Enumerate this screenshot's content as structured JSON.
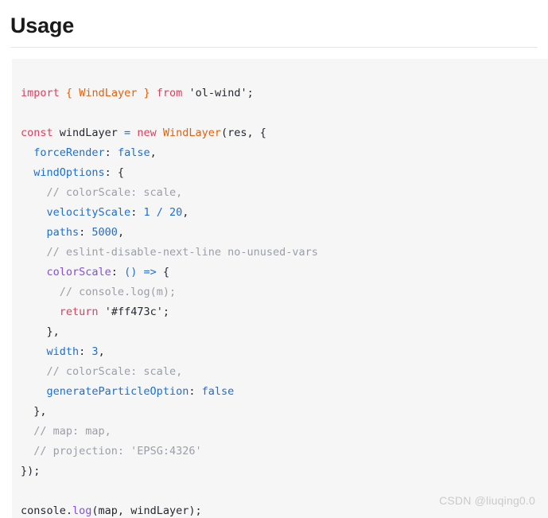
{
  "page": {
    "heading": "Usage",
    "watermark": "CSDN @liuqing0.0"
  },
  "colors": {
    "background": "#ffffff",
    "code_background": "#f6f6f7",
    "rule": "#e6e6e6",
    "heading_text": "#1a1a1a",
    "keyword": "#d9415f",
    "type": "#e36209",
    "property": "#1d6fd0",
    "number": "#1d6fd0",
    "boolean": "#1d6fd0",
    "function": "#8250df",
    "string": "#24292e",
    "comment": "#9aa0a6",
    "plain": "#24292e",
    "watermark": "#c9cacb"
  },
  "code": {
    "language": "javascript",
    "raw": "import { WindLayer } from 'ol-wind';\n\nconst windLayer = new WindLayer(res, {\n    forceRender: false,\n    windOptions: {\n      // colorScale: scale,\n      velocityScale: 1 / 20,\n      paths: 5000,\n      // eslint-disable-next-line no-unused-vars\n      colorScale: () => {\n        // console.log(m);\n        return '#ff473c';\n      },\n      width: 3,\n      // colorScale: scale,\n      generateParticleOption: false\n    },\n    // map: map,\n    // projection: 'EPSG:4326'\n});\n\nconsole.log(map, windLayer);",
    "lines": [
      {
        "indent": 0,
        "tokens": [
          {
            "t": "import",
            "c": "kw"
          },
          {
            "t": " ",
            "c": "plain"
          },
          {
            "t": "{",
            "c": "type"
          },
          {
            "t": " ",
            "c": "plain"
          },
          {
            "t": "WindLayer",
            "c": "type"
          },
          {
            "t": " ",
            "c": "plain"
          },
          {
            "t": "}",
            "c": "type"
          },
          {
            "t": " ",
            "c": "plain"
          },
          {
            "t": "from",
            "c": "kw"
          },
          {
            "t": " ",
            "c": "plain"
          },
          {
            "t": "'ol-wind';",
            "c": "str"
          }
        ]
      },
      {
        "indent": 0,
        "tokens": []
      },
      {
        "indent": 0,
        "tokens": [
          {
            "t": "const",
            "c": "kw"
          },
          {
            "t": " windLayer ",
            "c": "plain"
          },
          {
            "t": "=",
            "c": "op"
          },
          {
            "t": " ",
            "c": "plain"
          },
          {
            "t": "new",
            "c": "kw"
          },
          {
            "t": " ",
            "c": "plain"
          },
          {
            "t": "WindLayer",
            "c": "type"
          },
          {
            "t": "(res, {",
            "c": "plain"
          }
        ]
      },
      {
        "indent": 1,
        "tokens": [
          {
            "t": "forceRender",
            "c": "prop"
          },
          {
            "t": ": ",
            "c": "plain"
          },
          {
            "t": "false",
            "c": "bool"
          },
          {
            "t": ",",
            "c": "plain"
          }
        ]
      },
      {
        "indent": 1,
        "tokens": [
          {
            "t": "windOptions",
            "c": "prop"
          },
          {
            "t": ": {",
            "c": "plain"
          }
        ]
      },
      {
        "indent": 2,
        "tokens": [
          {
            "t": "// colorScale: scale,",
            "c": "comment"
          }
        ]
      },
      {
        "indent": 2,
        "tokens": [
          {
            "t": "velocityScale",
            "c": "prop"
          },
          {
            "t": ": ",
            "c": "plain"
          },
          {
            "t": "1",
            "c": "num"
          },
          {
            "t": " ",
            "c": "plain"
          },
          {
            "t": "/",
            "c": "op"
          },
          {
            "t": " ",
            "c": "plain"
          },
          {
            "t": "20",
            "c": "num"
          },
          {
            "t": ",",
            "c": "plain"
          }
        ]
      },
      {
        "indent": 2,
        "tokens": [
          {
            "t": "paths",
            "c": "prop"
          },
          {
            "t": ": ",
            "c": "plain"
          },
          {
            "t": "5000",
            "c": "num"
          },
          {
            "t": ",",
            "c": "plain"
          }
        ]
      },
      {
        "indent": 2,
        "tokens": [
          {
            "t": "// eslint-disable-next-line no-unused-vars",
            "c": "comment"
          }
        ]
      },
      {
        "indent": 2,
        "tokens": [
          {
            "t": "colorScale",
            "c": "fn"
          },
          {
            "t": ": ",
            "c": "plain"
          },
          {
            "t": "()",
            "c": "op"
          },
          {
            "t": " ",
            "c": "plain"
          },
          {
            "t": "=>",
            "c": "op"
          },
          {
            "t": " {",
            "c": "plain"
          }
        ]
      },
      {
        "indent": 3,
        "tokens": [
          {
            "t": "// console.log(m);",
            "c": "comment"
          }
        ]
      },
      {
        "indent": 3,
        "tokens": [
          {
            "t": "return",
            "c": "kw"
          },
          {
            "t": " ",
            "c": "plain"
          },
          {
            "t": "'#ff473c';",
            "c": "str"
          }
        ]
      },
      {
        "indent": 2,
        "tokens": [
          {
            "t": "},",
            "c": "plain"
          }
        ]
      },
      {
        "indent": 2,
        "tokens": [
          {
            "t": "width",
            "c": "prop"
          },
          {
            "t": ": ",
            "c": "plain"
          },
          {
            "t": "3",
            "c": "num"
          },
          {
            "t": ",",
            "c": "plain"
          }
        ]
      },
      {
        "indent": 2,
        "tokens": [
          {
            "t": "// colorScale: scale,",
            "c": "comment"
          }
        ]
      },
      {
        "indent": 2,
        "tokens": [
          {
            "t": "generateParticleOption",
            "c": "prop"
          },
          {
            "t": ": ",
            "c": "plain"
          },
          {
            "t": "false",
            "c": "bool"
          }
        ]
      },
      {
        "indent": 1,
        "tokens": [
          {
            "t": "},",
            "c": "plain"
          }
        ]
      },
      {
        "indent": 1,
        "tokens": [
          {
            "t": "// map: map,",
            "c": "comment"
          }
        ]
      },
      {
        "indent": 1,
        "tokens": [
          {
            "t": "// projection: 'EPSG:4326'",
            "c": "comment"
          }
        ]
      },
      {
        "indent": 0,
        "tokens": [
          {
            "t": "});",
            "c": "plain"
          }
        ]
      },
      {
        "indent": 0,
        "tokens": []
      },
      {
        "indent": 0,
        "tokens": [
          {
            "t": "console.",
            "c": "plain"
          },
          {
            "t": "log",
            "c": "fn"
          },
          {
            "t": "(map, windLayer);",
            "c": "plain"
          }
        ]
      }
    ]
  }
}
